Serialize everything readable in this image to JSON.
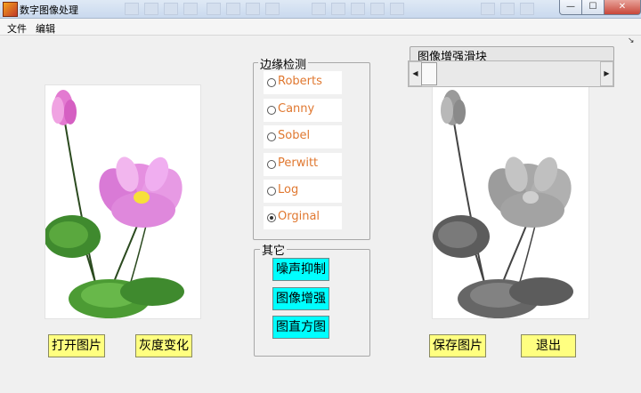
{
  "window": {
    "title": "数字图像处理"
  },
  "menu": {
    "items": [
      "文件",
      "编辑"
    ]
  },
  "edge_detection": {
    "title": "边缘检测",
    "options": [
      "Roberts",
      "Canny",
      "Sobel",
      "Perwitt",
      "Log",
      "Orginal"
    ],
    "selected": "Orginal"
  },
  "other": {
    "title": "其它",
    "buttons": [
      "噪声抑制",
      "图像增强",
      "图直方图"
    ]
  },
  "slider": {
    "title": "图像增强滑块",
    "value_fraction": 0.0
  },
  "buttons": {
    "open": "打开图片",
    "gray": "灰度变化",
    "save": "保存图片",
    "exit": "退出"
  },
  "colors": {
    "button_cyan": "#00ffff",
    "button_yellow": "#ffff80",
    "radio_text": "#e07830"
  }
}
